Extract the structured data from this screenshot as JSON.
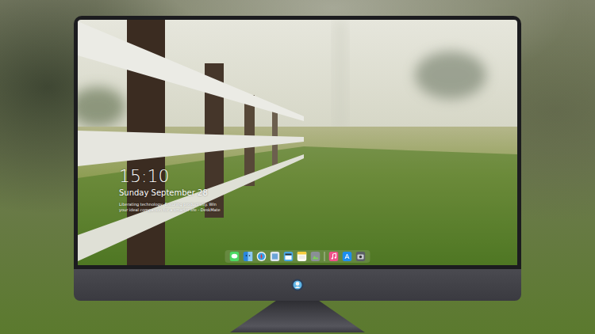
{
  "lock_screen": {
    "time": "15:10",
    "date": "Sunday September 28",
    "tagline": [
      "Liberating technology, Ensuring productivity. Win",
      "your ideal companion for a smarter life - DeskMate"
    ]
  }
}
